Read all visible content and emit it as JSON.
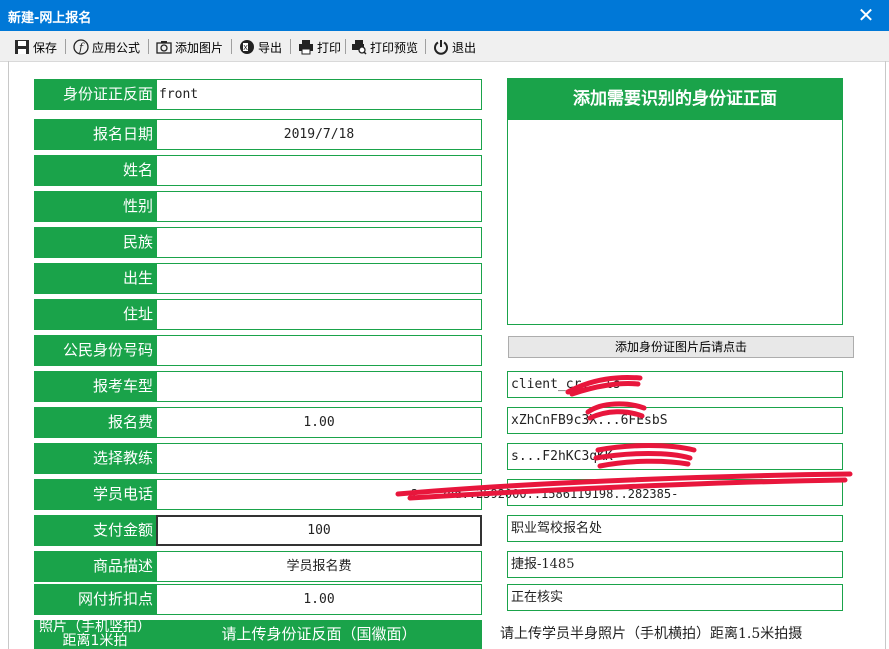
{
  "window": {
    "title": "新建-网上报名",
    "close": "✕"
  },
  "toolbar": [
    {
      "label": "保存",
      "icon": "save-icon"
    },
    {
      "label": "应用公式",
      "icon": "formula-icon"
    },
    {
      "label": "添加图片",
      "icon": "camera-icon"
    },
    {
      "label": "导出",
      "icon": "export-icon"
    },
    {
      "label": "打印",
      "icon": "printer-icon"
    },
    {
      "label": "打印预览",
      "icon": "print-preview-icon"
    },
    {
      "label": "退出",
      "icon": "power-icon"
    }
  ],
  "form": {
    "rows": [
      {
        "label": "身份证正反面",
        "value": "front"
      },
      {
        "label": "报名日期",
        "value": "2019/7/18"
      },
      {
        "label": "姓名",
        "value": ""
      },
      {
        "label": "性别",
        "value": ""
      },
      {
        "label": "民族",
        "value": ""
      },
      {
        "label": "出生",
        "value": ""
      },
      {
        "label": "住址",
        "value": ""
      },
      {
        "label": "公民身份号码",
        "value": ""
      },
      {
        "label": "报考车型",
        "value": ""
      },
      {
        "label": "报名费",
        "value": "1.00"
      },
      {
        "label": "选择教练",
        "value": ""
      },
      {
        "label": "学员电话",
        "value": "2...2bd..2592000..1586119198..282385-"
      },
      {
        "label": "支付金额",
        "value": "100"
      },
      {
        "label": "商品描述",
        "value": "学员报名费"
      },
      {
        "label": "网付折扣点",
        "value": "1.00"
      }
    ],
    "bottom": {
      "label": "照片（手机竖拍）距离1米拍",
      "upload_back": "请上传身份证反面（国徽面）",
      "upload_photo": "请上传学员半身照片（手机横拍）距离1.5米拍摄"
    }
  },
  "right": {
    "photo_title": "添加需要识别的身份证正面",
    "action_button": "添加身份证图片后请点击",
    "fields": [
      "client_cr...ls",
      "xZhCnFB9c3X...6FEsbS",
      "s...F2hKC3qKK",
      "",
      "职业驾校报名处",
      "捷报-1485",
      "正在核实"
    ]
  },
  "colors": {
    "accent": "#1aa34a",
    "titlebar": "#0078d7",
    "redaction": "#e8163c"
  }
}
